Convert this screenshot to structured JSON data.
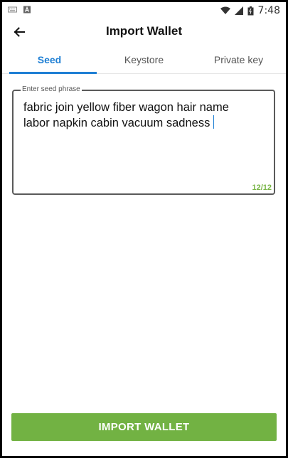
{
  "status_bar": {
    "time": "7:48",
    "icons": [
      "keyboard-icon",
      "app-notification-icon",
      "wifi-icon",
      "signal-icon",
      "battery-icon"
    ]
  },
  "header": {
    "title": "Import Wallet",
    "back_icon": "arrow-left-icon"
  },
  "tabs": [
    {
      "label": "Seed",
      "active": true
    },
    {
      "label": "Keystore",
      "active": false
    },
    {
      "label": "Private key",
      "active": false
    }
  ],
  "seed_field": {
    "label": "Enter seed phrase",
    "value_line1": "fabric join yellow fiber wagon hair name",
    "value_line2": "labor napkin cabin vacuum sadness",
    "counter": "12/12"
  },
  "import_button": {
    "label": "IMPORT WALLET"
  },
  "colors": {
    "accent_blue": "#1e7fd4",
    "button_green": "#72b243",
    "counter_green": "#7ab648"
  }
}
